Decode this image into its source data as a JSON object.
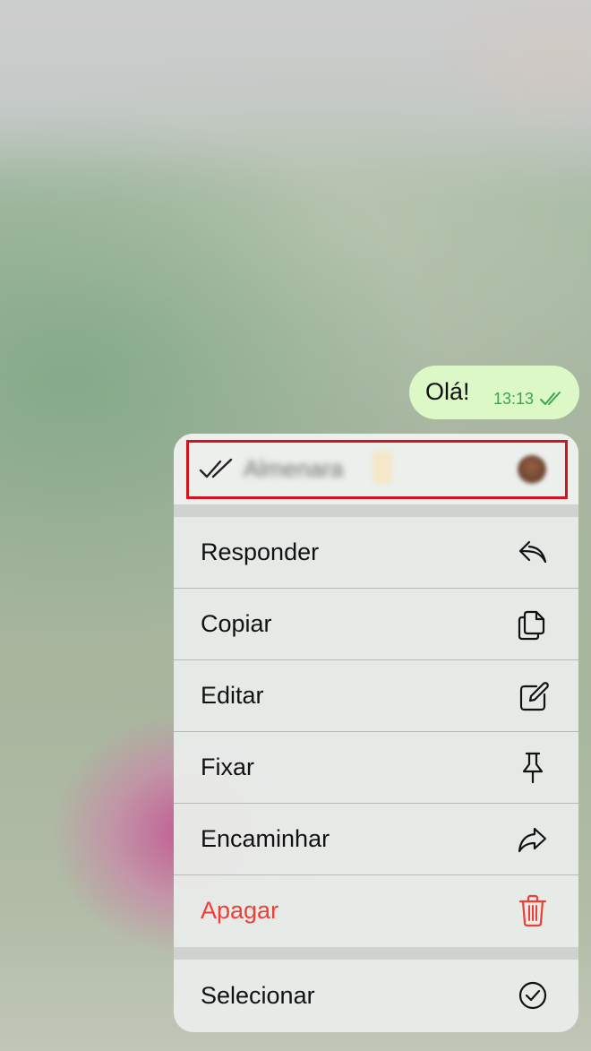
{
  "message": {
    "text": "Olá!",
    "time": "13:13",
    "status_icon": "double-check-icon",
    "bubble_color": "#dcf8c6",
    "time_color": "#3aa64b"
  },
  "read_by": {
    "status_icon": "double-check-icon",
    "name": "Almenara"
  },
  "menu": {
    "items": [
      {
        "label": "Responder",
        "icon": "reply-icon"
      },
      {
        "label": "Copiar",
        "icon": "copy-icon"
      },
      {
        "label": "Editar",
        "icon": "edit-icon"
      },
      {
        "label": "Fixar",
        "icon": "pin-icon"
      },
      {
        "label": "Encaminhar",
        "icon": "forward-icon"
      },
      {
        "label": "Apagar",
        "icon": "trash-icon",
        "color": "#ef3f35"
      },
      {
        "label": "Selecionar",
        "icon": "checkmark-circle-icon"
      }
    ]
  },
  "highlight_color": "#d3131d"
}
